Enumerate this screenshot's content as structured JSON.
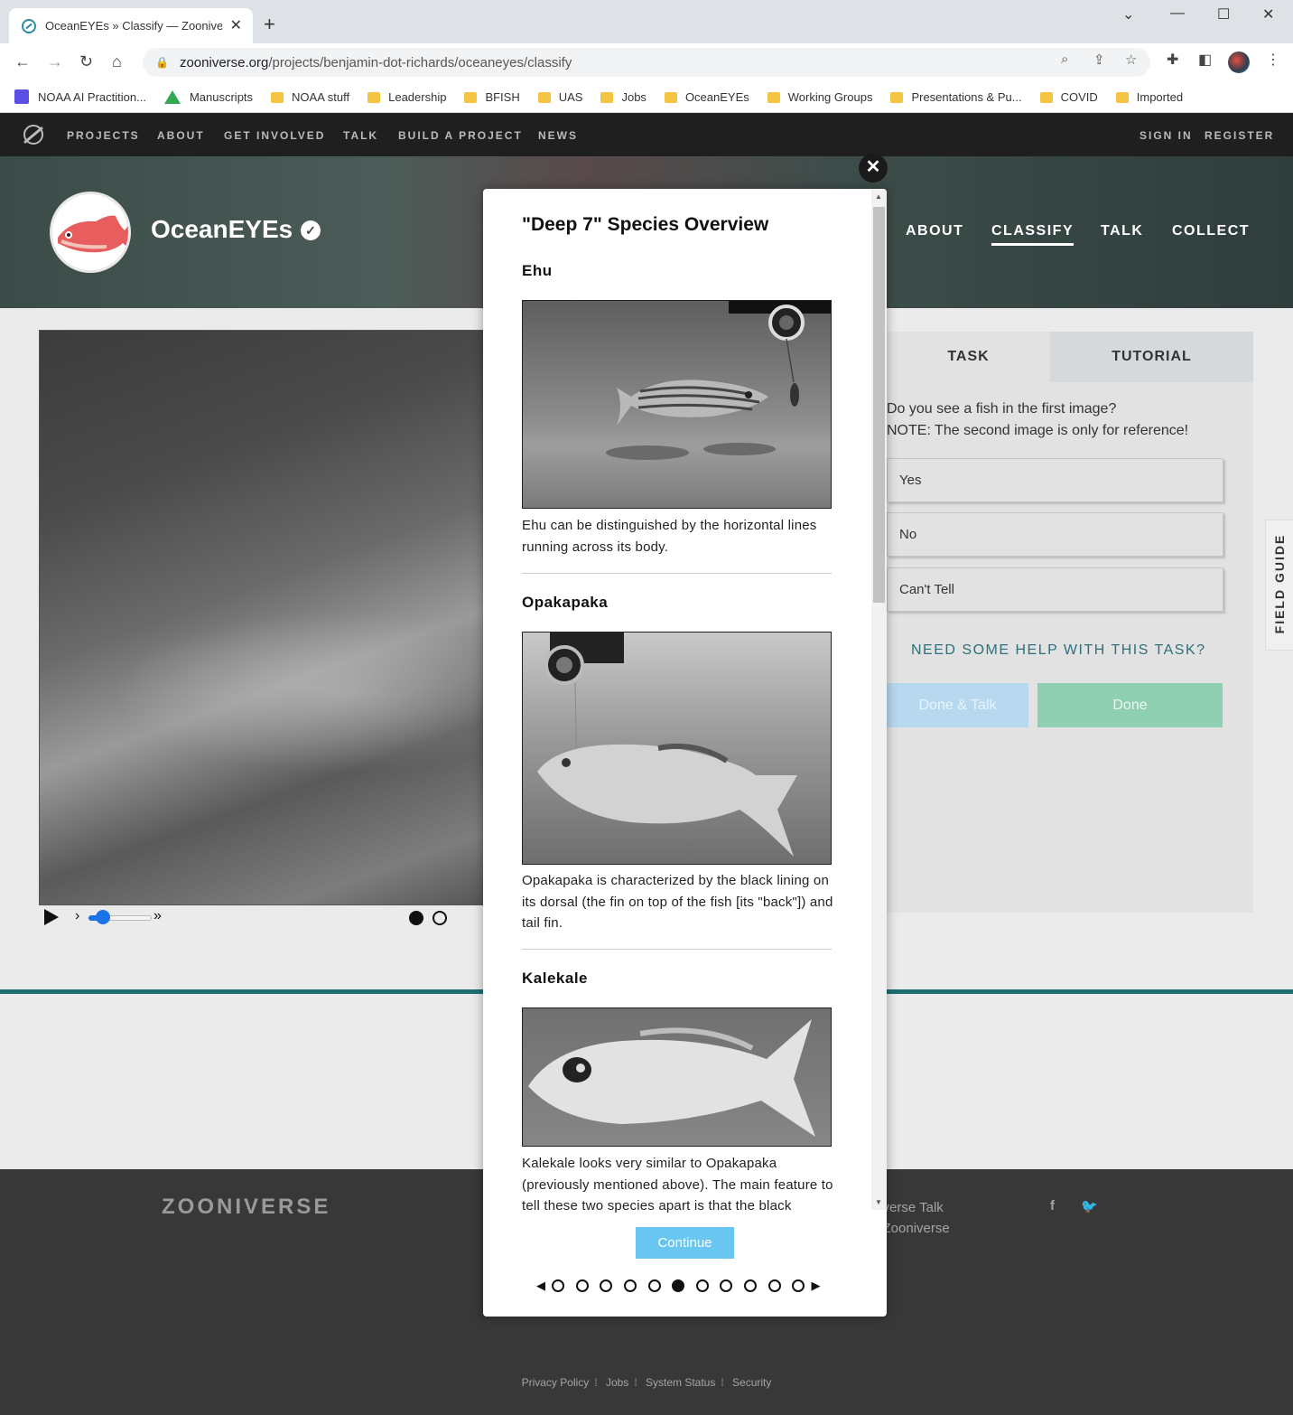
{
  "browser": {
    "tab_title": "OceanEYEs » Classify — Zooniverse",
    "url_host": "zooniverse.org",
    "url_path": "/projects/benjamin-dot-richards/oceaneyes/classify",
    "bookmarks": [
      "NOAA AI Practition...",
      "Manuscripts",
      "NOAA stuff",
      "Leadership",
      "BFISH",
      "UAS",
      "Jobs",
      "OceanEYEs",
      "Working Groups",
      "Presentations & Pu...",
      "COVID",
      "Imported"
    ]
  },
  "zoonav": {
    "items": [
      "PROJECTS",
      "ABOUT",
      "GET INVOLVED",
      "TALK",
      "BUILD A PROJECT",
      "NEWS"
    ],
    "sign_in": "SIGN IN",
    "register": "REGISTER"
  },
  "project": {
    "title": "OceanEYEs",
    "nav": [
      "ABOUT",
      "CLASSIFY",
      "TALK",
      "COLLECT"
    ]
  },
  "task": {
    "tabs": [
      "TASK",
      "TUTORIAL"
    ],
    "question_line1": "Do you see a fish in the first image?",
    "question_line2": "NOTE: The second image is only for reference!",
    "answers": [
      "Yes",
      "No",
      "Can't Tell"
    ],
    "help": "NEED SOME HELP WITH THIS TASK?",
    "done_talk": "Done & Talk",
    "done": "Done",
    "field_guide": "FIELD GUIDE"
  },
  "modal": {
    "title": "\"Deep 7\" Species Overview",
    "species": [
      {
        "name": "Ehu",
        "description": "Ehu can be distinguished by the horizontal lines running across its body."
      },
      {
        "name": "Opakapaka",
        "description": "Opakapaka is characterized by the black lining on its dorsal (the fin on top of the fish [its \"back\"]) and tail fin."
      },
      {
        "name": "Kalekale",
        "description": "Kalekale looks very similar to Opakapaka (previously mentioned above). The main feature to tell these two species apart is that the black"
      }
    ],
    "continue": "Continue",
    "pager": {
      "total": 11,
      "current": 6
    }
  },
  "footer": {
    "wordmark": "ZOONIVERSE",
    "col_text_1": "Zooniverse Talk",
    "col_text_2": "Daily Zooniverse",
    "links": [
      "Privacy Policy",
      "Jobs",
      "System Status",
      "Security"
    ]
  }
}
